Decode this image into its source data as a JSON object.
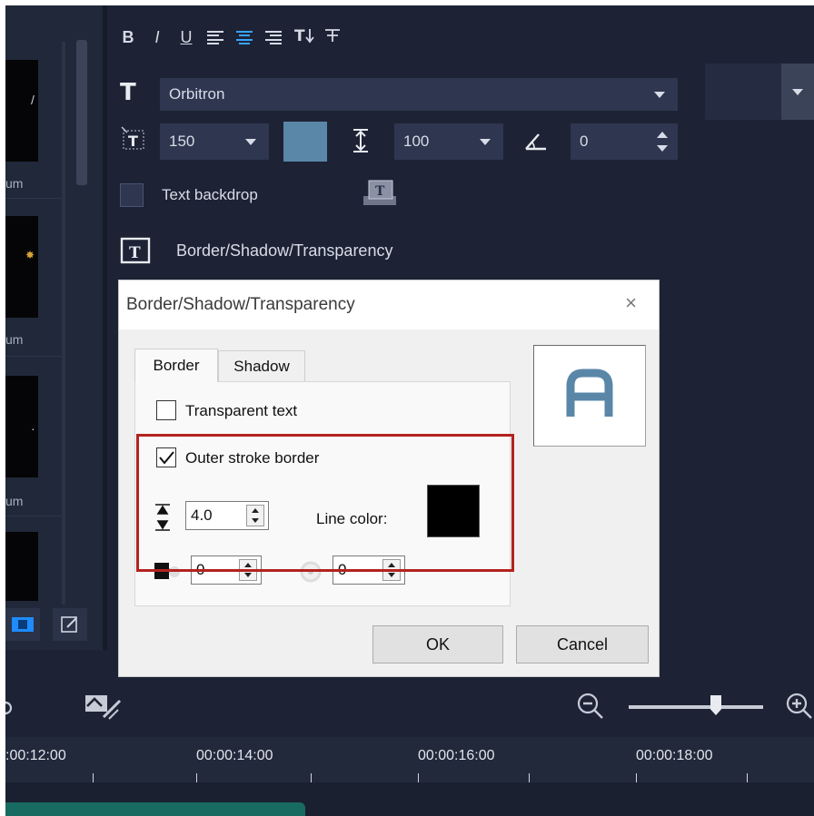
{
  "library": {
    "labels": [
      "um",
      "um",
      "um"
    ]
  },
  "title_panel": {
    "format": {
      "bold": "B",
      "italic": "I",
      "underline": "U"
    },
    "font": {
      "value": "Orbitron"
    },
    "font_size": {
      "value": "150"
    },
    "line_spacing": {
      "value": "100"
    },
    "rotation": {
      "value": "0"
    },
    "text_backdrop_label": "Text backdrop",
    "border_shadow_label": "Border/Shadow/Transparency",
    "text_color": "#5a87a8"
  },
  "dialog": {
    "title": "Border/Shadow/Transparency",
    "close_glyph": "×",
    "tabs": [
      {
        "label": "Border",
        "active": true
      },
      {
        "label": "Shadow",
        "active": false
      }
    ],
    "transparent_text": {
      "label": "Transparent text",
      "checked": false
    },
    "outer_stroke": {
      "label": "Outer stroke border",
      "checked": true
    },
    "border_width": {
      "value": "4.0"
    },
    "line_color_label": "Line color:",
    "line_color": "#000000",
    "transparency": {
      "value": "0"
    },
    "softness": {
      "value": "0"
    },
    "ok_label": "OK",
    "cancel_label": "Cancel",
    "preview_letter": "A",
    "highlight_color": "#b3231e"
  },
  "timeline": {
    "ruler_labels": [
      ":00:12:00",
      "00:00:14:00",
      "00:00:16:00",
      "00:00:18:00"
    ]
  },
  "colors": {
    "app_bg": "#1d2335",
    "field_bg": "#2e3650",
    "accent_blue": "#3aa3ff",
    "clip_teal": "#186b60"
  }
}
